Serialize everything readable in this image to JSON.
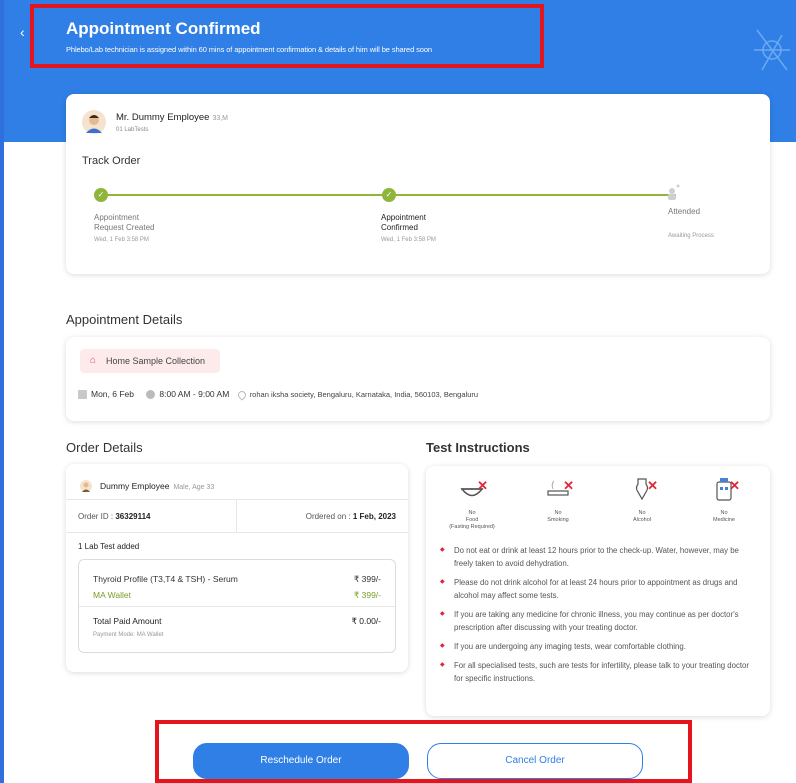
{
  "header": {
    "back_icon": "back-arrow-icon",
    "title": "Appointment Confirmed",
    "subtitle": "Phlebo/Lab technician is assigned within 60 mins of appointment confirmation & details of him will be shared soon"
  },
  "patient": {
    "name": "Mr. Dummy Employee",
    "age": "33,M",
    "tests": "01 LabTests"
  },
  "tracking": {
    "title": "Track Order",
    "steps": [
      {
        "label_line1": "Appointment",
        "label_line2": "Request Created",
        "time": "Wed, 1 Feb 3:58 PM",
        "status": "done"
      },
      {
        "label_line1": "Appointment",
        "label_line2": "Confirmed",
        "time": "Wed, 1 Feb 3:58 PM",
        "status": "done"
      },
      {
        "label_line1": "Attended",
        "label_line2": "",
        "time": "Awaiting Process",
        "status": "pending"
      }
    ]
  },
  "appointment": {
    "section_title": "Appointment Details",
    "collection_type": "Home Sample Collection",
    "date": "Mon, 6 Feb",
    "time": "8:00 AM - 9:00 AM",
    "address": "rohan iksha society, Bengaluru, Karnataka, India, 560103, Bengaluru"
  },
  "order": {
    "section_title": "Order Details",
    "patient_name": "Dummy Employee",
    "patient_meta": "Male, Age 33",
    "order_id_label": "Order ID : ",
    "order_id": "36329114",
    "ordered_on_label": "Ordered on : ",
    "ordered_on": "1 Feb, 2023",
    "tests_added": "1 Lab Test added",
    "test_name": "Thyroid Profile (T3,T4 & TSH) - Serum",
    "test_price": "₹ 399/-",
    "wallet_label": "MA Wallet",
    "wallet_price": "₹ 399/-",
    "total_label": "Total Paid Amount",
    "total_value": "₹ 0.00/-",
    "payment_mode": "Payment Mode: MA Wallet"
  },
  "instructions": {
    "title": "Test Instructions",
    "icons": [
      {
        "icon": "no-food-icon",
        "line1": "No",
        "line2": "Food",
        "line3": "(Fasting Required)"
      },
      {
        "icon": "no-smoking-icon",
        "line1": "No",
        "line2": "Smoking",
        "line3": ""
      },
      {
        "icon": "no-alcohol-icon",
        "line1": "No",
        "line2": "Alcohol",
        "line3": ""
      },
      {
        "icon": "no-medicine-icon",
        "line1": "No",
        "line2": "Medicine",
        "line3": ""
      }
    ],
    "items": [
      "Do not eat or drink at least 12 hours prior to the check-up. Water, however, may be freely taken to avoid dehydration.",
      "Please do not drink alcohol for at least 24 hours prior to appointment as drugs and alcohol may affect some tests.",
      "If you are taking any medicine for chronic illness, you may continue as per doctor's prescription after discussing with your treating doctor.",
      "If you are undergoing any imaging tests, wear comfortable clothing.",
      "For all specialised tests, such are tests for infertility, please talk to your treating doctor for specific instructions."
    ]
  },
  "actions": {
    "reschedule": "Reschedule Order",
    "cancel": "Cancel Order"
  },
  "colors": {
    "brand_blue": "#2f7fe6",
    "success_green": "#8fb53a",
    "highlight_red": "#e3161f"
  }
}
